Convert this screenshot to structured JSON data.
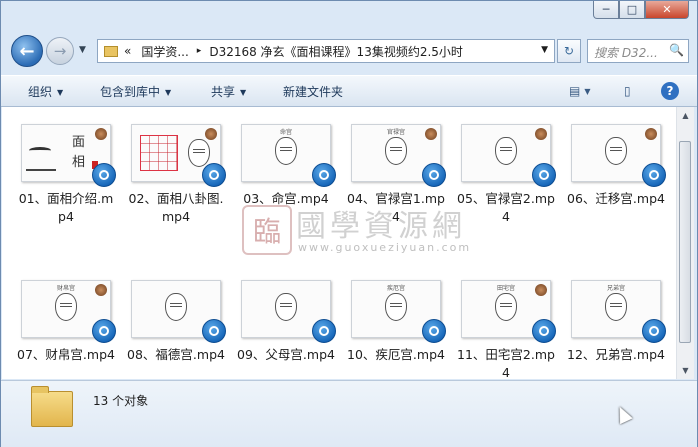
{
  "window": {
    "controls": [
      "─",
      "□",
      "✕"
    ]
  },
  "nav": {
    "back": "←",
    "forward": "→",
    "address": {
      "chevrons": "«",
      "crumb1": "国学资...",
      "separator": "▸",
      "crumb2": "D32168 净玄《面相课程》13集视频约2.5小时"
    },
    "search_placeholder": "搜索 D32...",
    "search_icon": "🔍"
  },
  "toolbar": {
    "organize": "组织",
    "include": "包含到库中",
    "share": "共享",
    "new_folder": "新建文件夹"
  },
  "files": [
    {
      "label": "01、面相介绍.mp4",
      "thumb": "intro",
      "big_text": "面\n相"
    },
    {
      "label": "02、面相八卦图.mp4",
      "thumb": "bagua"
    },
    {
      "label": "03、命宫.mp4",
      "thumb": "face",
      "slide_title": "命宫"
    },
    {
      "label": "04、官禄宫1.mp4",
      "thumb": "face",
      "slide_title": "官禄宫"
    },
    {
      "label": "05、官禄宫2.mp4",
      "thumb": "face",
      "slide_title": ""
    },
    {
      "label": "06、迁移宫.mp4",
      "thumb": "face",
      "slide_title": ""
    },
    {
      "label": "07、财帛宫.mp4",
      "thumb": "face",
      "slide_title": "财帛宫"
    },
    {
      "label": "08、福德宫.mp4",
      "thumb": "face",
      "slide_title": ""
    },
    {
      "label": "09、父母宫.mp4",
      "thumb": "face",
      "slide_title": ""
    },
    {
      "label": "10、疾厄宫.mp4",
      "thumb": "face",
      "slide_title": "疾厄宫"
    },
    {
      "label": "11、田宅宫2.mp4",
      "thumb": "face",
      "slide_title": "田宅宫"
    },
    {
      "label": "12、兄弟宫.mp4",
      "thumb": "face",
      "slide_title": "兄弟宫"
    }
  ],
  "watermark": {
    "logo_char": "臨",
    "name": "國學資源網",
    "url": "www.guoxueziyuan.com"
  },
  "status": {
    "count_text": "13 个对象"
  }
}
